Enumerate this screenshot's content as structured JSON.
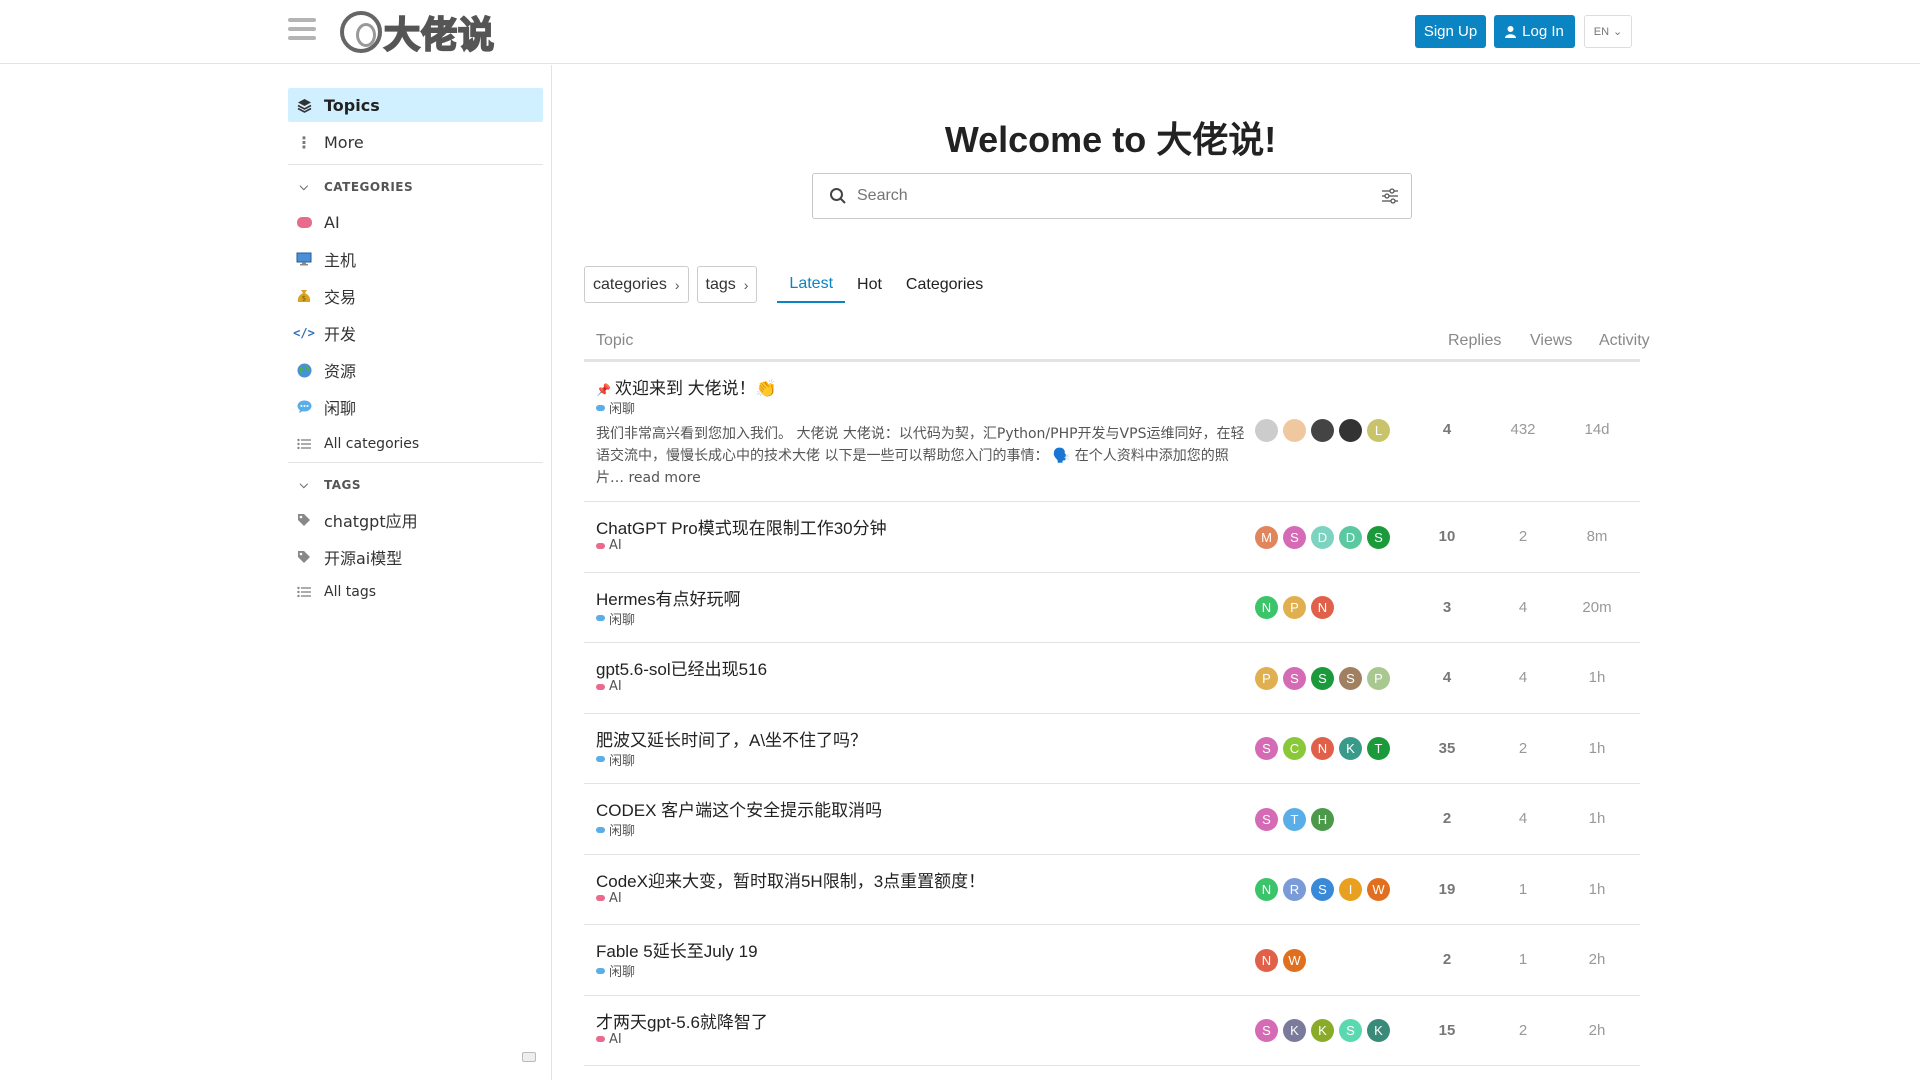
{
  "header": {
    "logo_text": "大佬说",
    "signup_label": "Sign Up",
    "login_label": "Log In",
    "lang_label": "EN"
  },
  "sidebar": {
    "topics_label": "Topics",
    "more_label": "More",
    "categories_heading": "CATEGORIES",
    "categories": [
      {
        "label": "AI",
        "color": "#e86a8c"
      },
      {
        "label": "主机",
        "color": "#4a90d9"
      },
      {
        "label": "交易",
        "color": "#d9a520"
      },
      {
        "label": "开发",
        "color": "#2d6fb8"
      },
      {
        "label": "资源",
        "color": "#4caf50"
      },
      {
        "label": "闲聊",
        "color": "#5aaee8"
      }
    ],
    "all_categories_label": "All categories",
    "tags_heading": "TAGS",
    "tags": [
      {
        "label": "chatgpt应用"
      },
      {
        "label": "开源ai模型"
      }
    ],
    "all_tags_label": "All tags"
  },
  "main": {
    "welcome": "Welcome to 大佬说!",
    "search_placeholder": "Search",
    "filter_categories": "categories",
    "filter_tags": "tags",
    "tabs": [
      {
        "label": "Latest"
      },
      {
        "label": "Hot"
      },
      {
        "label": "Categories"
      }
    ],
    "columns": {
      "topic": "Topic",
      "replies": "Replies",
      "views": "Views",
      "activity": "Activity"
    },
    "topics": [
      {
        "title": "欢迎来到 大佬说！👏",
        "category": "闲聊",
        "cat_color": "#5aaee8",
        "excerpt": "我们非常高兴看到您加入我们。 大佬说 大佬说：以代码为契，汇Python/PHP开发与VPS运维同好，在轻语交流中，慢慢长成心中的技术大佬 以下是一些可以帮助您入门的事情： 🗣️ 在个人资料中添加您的照片…",
        "read_more": "read more",
        "replies": "4",
        "views": "432",
        "activity": "14d",
        "avatars": [
          {
            "letter": "",
            "color": "#cccccc"
          },
          {
            "letter": "",
            "color": "#f0c8a0"
          },
          {
            "letter": "",
            "color": "#444444"
          },
          {
            "letter": "",
            "color": "#333333"
          },
          {
            "letter": "L",
            "color": "#c9c46a"
          }
        ]
      },
      {
        "title": "ChatGPT Pro模式现在限制工作30分钟",
        "category": "AI",
        "cat_color": "#e86a8c",
        "replies": "10",
        "views": "2",
        "activity": "8m",
        "avatars": [
          {
            "letter": "M",
            "color": "#e0855c"
          },
          {
            "letter": "S",
            "color": "#d56bb5"
          },
          {
            "letter": "D",
            "color": "#7dd3c0"
          },
          {
            "letter": "D",
            "color": "#5bc9a0"
          },
          {
            "letter": "S",
            "color": "#1a9a3a"
          }
        ]
      },
      {
        "title": "Hermes有点好玩啊",
        "category": "闲聊",
        "cat_color": "#5aaee8",
        "replies": "3",
        "views": "4",
        "activity": "20m",
        "avatars": [
          {
            "letter": "N",
            "color": "#3cc46a"
          },
          {
            "letter": "P",
            "color": "#e0b050"
          },
          {
            "letter": "N",
            "color": "#e0604a"
          }
        ]
      },
      {
        "title": "gpt5.6-sol已经出现516",
        "category": "AI",
        "cat_color": "#e86a8c",
        "replies": "4",
        "views": "4",
        "activity": "1h",
        "avatars": [
          {
            "letter": "P",
            "color": "#e0b050"
          },
          {
            "letter": "S",
            "color": "#d56bb5"
          },
          {
            "letter": "S",
            "color": "#1a9a3a"
          },
          {
            "letter": "S",
            "color": "#a08060"
          },
          {
            "letter": "P",
            "color": "#a8c890"
          }
        ]
      },
      {
        "title": "肥波又延长时间了，A\\坐不住了吗？",
        "category": "闲聊",
        "cat_color": "#5aaee8",
        "replies": "35",
        "views": "2",
        "activity": "1h",
        "avatars": [
          {
            "letter": "S",
            "color": "#d56bb5"
          },
          {
            "letter": "C",
            "color": "#8ac83a"
          },
          {
            "letter": "N",
            "color": "#e0604a"
          },
          {
            "letter": "K",
            "color": "#3a9a8a"
          },
          {
            "letter": "T",
            "color": "#1a9a3a"
          }
        ]
      },
      {
        "title": "CODEX 客户端这个安全提示能取消吗",
        "category": "闲聊",
        "cat_color": "#5aaee8",
        "replies": "2",
        "views": "4",
        "activity": "1h",
        "avatars": [
          {
            "letter": "S",
            "color": "#d56bb5"
          },
          {
            "letter": "T",
            "color": "#5aaee8"
          },
          {
            "letter": "H",
            "color": "#4a9a4a"
          }
        ]
      },
      {
        "title": "CodeX迎来大变，暂时取消5H限制，3点重置额度！",
        "category": "AI",
        "cat_color": "#e86a8c",
        "replies": "19",
        "views": "1",
        "activity": "1h",
        "avatars": [
          {
            "letter": "N",
            "color": "#3cc46a"
          },
          {
            "letter": "R",
            "color": "#7a9ad8"
          },
          {
            "letter": "S",
            "color": "#3a8ad8"
          },
          {
            "letter": "I",
            "color": "#e8a020"
          },
          {
            "letter": "W",
            "color": "#e07020"
          }
        ]
      },
      {
        "title": "Fable 5延长至July 19",
        "category": "闲聊",
        "cat_color": "#5aaee8",
        "replies": "2",
        "views": "1",
        "activity": "2h",
        "avatars": [
          {
            "letter": "N",
            "color": "#e0604a"
          },
          {
            "letter": "W",
            "color": "#e07020"
          }
        ]
      },
      {
        "title": "才两天gpt-5.6就降智了",
        "category": "AI",
        "cat_color": "#e86a8c",
        "replies": "15",
        "views": "2",
        "activity": "2h",
        "avatars": [
          {
            "letter": "S",
            "color": "#d56bb5"
          },
          {
            "letter": "K",
            "color": "#7a7a9a"
          },
          {
            "letter": "K",
            "color": "#8aaa2a"
          },
          {
            "letter": "S",
            "color": "#5ad8b0"
          },
          {
            "letter": "K",
            "color": "#3a8a7a"
          }
        ]
      }
    ]
  }
}
